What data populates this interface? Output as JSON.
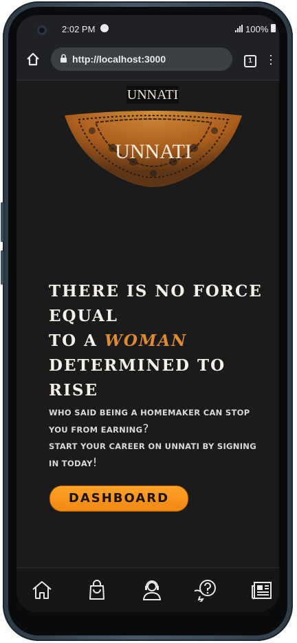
{
  "status_bar": {
    "time": "2:02 PM",
    "battery": "100%",
    "icons": [
      "spotify-icon",
      "signal-icon",
      "battery-icon"
    ]
  },
  "browser": {
    "url": "http://localhost:3000",
    "tab_count": "1",
    "icons": [
      "home-icon",
      "lock-icon",
      "overflow-menu-icon"
    ]
  },
  "brand": {
    "logo_small": "UNNATI",
    "logo_large": "UNNATI"
  },
  "hero": {
    "line1": "THERE IS NO FORCE",
    "line2": "EQUAL",
    "line3_prefix": "TO A ",
    "line3_highlight": "WOMAN",
    "line4": "DETERMINED TO",
    "line5": "RISE"
  },
  "subtext": {
    "line1": "WHO SAID BEING A HOMEMAKER CAN STOP",
    "line2": "YOU FROM EARNING",
    "line2_punct": "?",
    "line3": "START YOUR CAREER ON UNNATI BY SIGNING",
    "line4": "IN TODAY",
    "line4_punct": "!"
  },
  "cta": {
    "label": "DASHBOARD"
  },
  "bottom_nav": {
    "items": [
      "home-icon",
      "shopping-bag-icon",
      "support-agent-icon",
      "help-chat-icon",
      "news-icon"
    ]
  },
  "colors": {
    "background": "#1b1b1b",
    "accent": "#e08a34",
    "button": "#f89518",
    "text": "#f4f1ea"
  }
}
